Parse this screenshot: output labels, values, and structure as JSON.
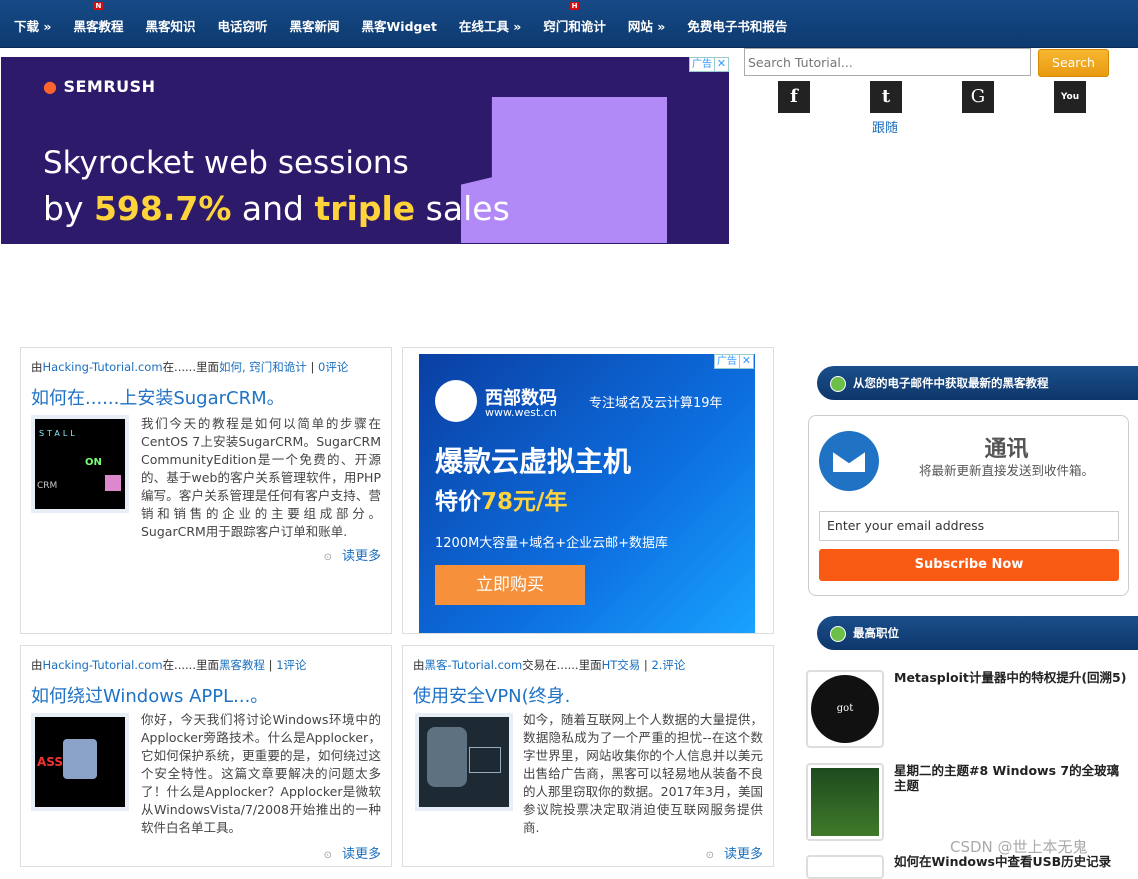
{
  "nav": {
    "items": [
      {
        "label": "下载 »",
        "badge": ""
      },
      {
        "label": "黑客教程",
        "badge": "N"
      },
      {
        "label": "黑客知识",
        "badge": ""
      },
      {
        "label": "电话窃听",
        "badge": ""
      },
      {
        "label": "黑客新闻",
        "badge": ""
      },
      {
        "label": "黑客Widget",
        "badge": ""
      },
      {
        "label": "在线工具 »",
        "badge": ""
      },
      {
        "label": "窍门和诡计",
        "badge": "H"
      },
      {
        "label": "网站 »",
        "badge": ""
      },
      {
        "label": "免费电子书和报告",
        "badge": ""
      }
    ]
  },
  "banner": {
    "brand": "SEMRUSH",
    "line1": "Skyrocket web sessions",
    "line2_pre": "by ",
    "line2_num": "598.7%",
    "line2_mid": " and ",
    "line2_em": "triple",
    "line2_post": " sales",
    "ad_tag": "广告",
    "close": "✕"
  },
  "search": {
    "placeholder": "Search Tutorial...",
    "button": "Search"
  },
  "social": {
    "icons": [
      {
        "name": "facebook-icon",
        "glyph": "f"
      },
      {
        "name": "twitter-icon",
        "glyph": "t"
      },
      {
        "name": "google-icon",
        "glyph": "G"
      },
      {
        "name": "youtube-icon",
        "glyph": "You"
      }
    ],
    "follow": "跟随"
  },
  "posts": [
    {
      "by": "由",
      "site": "Hacking-Tutorial.com",
      "in": "在......里面",
      "cats": "如何, 窍门和诡计",
      "sep": " | ",
      "comments": "0评论",
      "title": "如何在......上安装SugarCRM。",
      "text": "我们今天的教程是如何以简单的步骤在CentOS 7上安装SugarCRM。SugarCRM CommunityEdition是一个免费的、开源的、基于web的客户关系管理软件，用PHP编写。客户关系管理是任何有客户支持、营销和销售的企业的主要组成部分。SugarCRM用于跟踪客户订单和账单.",
      "more": "读更多"
    },
    {
      "by": "由",
      "site": "Hacking-Tutorial.com",
      "in": "在......里面",
      "cats": "黑客教程",
      "sep": " | ",
      "comments": "1评论",
      "title": "如何绕过Windows APPL...。",
      "text": "你好，今天我们将讨论Windows环境中的Applocker旁路技术。什么是Applocker，它如何保护系统，更重要的是，如何绕过这个安全特性。这篇文章要解决的问题太多了！什么是Applocker？Applocker是微软从WindowsVista/7/2008开始推出的一种软件白名单工具。",
      "more": "读更多"
    },
    {
      "by": "由",
      "site": "黑客-Tutorial.com",
      "in": "交易在......里面",
      "cats": "HT交易",
      "sep": " | ",
      "comments": "2.评论",
      "title": "使用安全VPN(终身.",
      "text": "如今，随着互联网上个人数据的大量提供，数据隐私成为了一个严重的担忧--在这个数字世界里，网站收集你的个人信息并以美元出售给广告商，黑客可以轻易地从装备不良的人那里窃取你的数据。2017年3月，美国参议院投票决定取消迫使互联网服务提供商.",
      "more": "读更多"
    }
  ],
  "ad2": {
    "brand": "西部数码",
    "url": "www.west.cn",
    "slogan": "专注域名及云计算19年",
    "headline": "爆款云虚拟主机",
    "price_pre": "特价",
    "price": "78元/年",
    "features": "1200M大容量+域名+企业云邮+数据库",
    "cta": "立即购买",
    "ad_tag": "广告",
    "close": "✕"
  },
  "sidebar": {
    "subscribe_header": "从您的电子邮件中获取最新的黑客教程",
    "sub_title": "通讯",
    "sub_desc": "将最新更新直接发送到收件箱。",
    "email_placeholder": "Enter your email address",
    "sub_button": "Subscribe Now",
    "popular_header": "最高职位",
    "popular": [
      {
        "title": "Metasploit计量器中的特权提升(回溯5)",
        "thumb_text": "got privilege?"
      },
      {
        "title": "星期二的主题#8 Windows 7的全玻璃主题",
        "thumb_text": ""
      },
      {
        "title": "如何在Windows中查看USB历史记录",
        "thumb_text": ""
      }
    ]
  },
  "watermark": "CSDN @世上本无鬼",
  "colors": {
    "nav": "#174a86",
    "link": "#1a6fbf",
    "subscribe": "#f95b14",
    "search": "#f0a820",
    "ad_purple": "#2e1a6b",
    "ad_blue": "#0a4fb5"
  }
}
